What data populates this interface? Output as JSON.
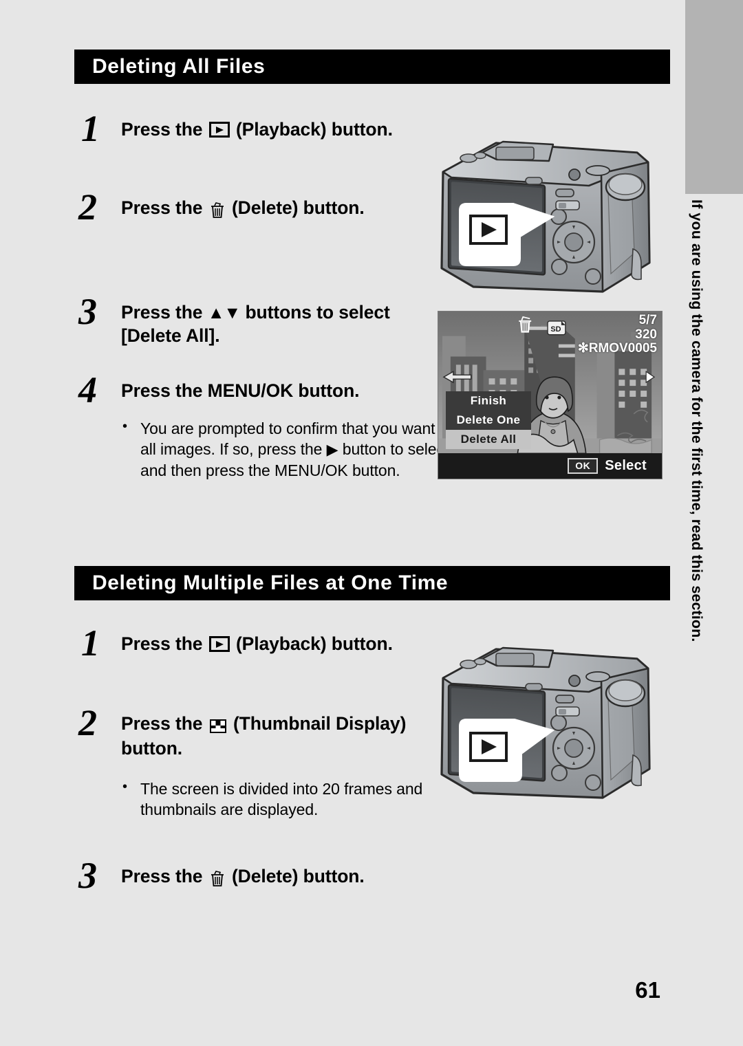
{
  "page": {
    "number": "61",
    "background_color": "#e6e6e6",
    "tab_color": "#b3b3b3"
  },
  "side_note": {
    "text": "If you are using the camera for the first time, read this section."
  },
  "sections": [
    {
      "heading": "Deleting All Files",
      "steps": [
        {
          "number": "1",
          "text_before": "Press the ",
          "icon": "playback-icon",
          "text_after": " (Playback) button."
        },
        {
          "number": "2",
          "text_before": "Press the ",
          "icon": "trash-icon",
          "text_after": " (Delete) button."
        },
        {
          "number": "3",
          "text_before": "Press the ",
          "icon": "up-down-arrows-icon",
          "text_after": " buttons to select [Delete All]."
        },
        {
          "number": "4",
          "text_before": "Press the MENU/OK button.",
          "icon": "",
          "text_after": ""
        }
      ],
      "bullets": [
        {
          "part1": "You are prompted to confirm that you want to delete all images. If so, press the ",
          "icon": "right-arrow-icon",
          "part2": " button to select [Yes], and then press the MENU/OK button."
        }
      ]
    },
    {
      "heading": "Deleting Multiple Files at One Time",
      "steps": [
        {
          "number": "1",
          "text_before": "Press the ",
          "icon": "playback-icon",
          "text_after": " (Playback) button."
        },
        {
          "number": "2",
          "text_before": "Press the ",
          "icon": "thumbnail-icon",
          "text_after": " (Thumbnail Display) button."
        },
        {
          "number": "3",
          "text_before": "Press the ",
          "icon": "trash-icon",
          "text_after": " (Delete) button."
        }
      ],
      "bullets": [
        {
          "part1": "The screen is divided into 20 frames and thumbnails are displayed.",
          "icon": "",
          "part2": ""
        }
      ]
    }
  ],
  "camera_illustrations": [
    {
      "callout_icon": "playback-icon",
      "alt": "Camera rear view with playback button callout"
    },
    {
      "callout_icon": "playback-icon",
      "alt": "Camera rear view with playback button callout"
    }
  ],
  "lcd_screen": {
    "indicators": {
      "card": "SD",
      "frame_count": "5/7",
      "resolution": "320",
      "filename": "✻RMOV0005",
      "trash_icon": "trash-icon",
      "left_arrow_icon": "left-arrow-icon",
      "right_arrow_icon": "right-arrow-icon"
    },
    "menu": {
      "items": [
        {
          "label": "Finish",
          "selected": false
        },
        {
          "label": "Delete One",
          "selected": false
        },
        {
          "label": "Delete All",
          "selected": true
        }
      ]
    },
    "footer": {
      "button": "OK",
      "action": "Select"
    }
  }
}
